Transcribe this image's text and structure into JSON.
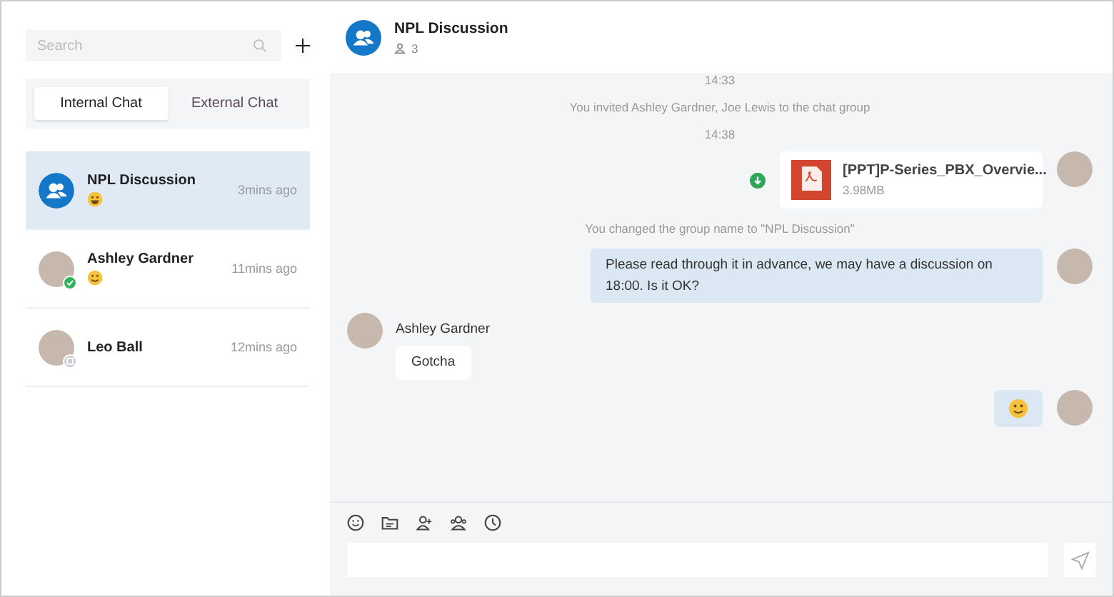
{
  "sidebar": {
    "search": {
      "placeholder": "Search"
    },
    "tabs": [
      {
        "label": "Internal Chat",
        "selected": true
      },
      {
        "label": "External Chat",
        "selected": false
      }
    ],
    "chats": [
      {
        "kind": "group",
        "name": "NPL Discussion",
        "emoji_preview": true,
        "time": "3mins ago",
        "selected": true
      },
      {
        "kind": "person",
        "name": "Ashley Gardner",
        "emoji_preview": true,
        "online": true,
        "time": "11mins ago",
        "selected": false
      },
      {
        "kind": "person",
        "name": "Leo Ball",
        "emoji_preview": false,
        "online": false,
        "time": "12mins ago",
        "selected": false
      }
    ]
  },
  "conversation": {
    "title": "NPL Discussion",
    "members": "3",
    "messages": [
      {
        "kind": "time",
        "text": "14:33"
      },
      {
        "kind": "system",
        "text": "You invited Ashley Gardner, Joe Lewis to the chat group"
      },
      {
        "kind": "time",
        "text": "14:38"
      },
      {
        "kind": "file",
        "name": "[PPT]P-Series_PBX_Overvie...",
        "size": "3.98MB"
      },
      {
        "kind": "system",
        "text": "You changed the group name to \"NPL Discussion\""
      },
      {
        "kind": "outgoing",
        "text": "Please read through it in advance, we may have a discussion on 18:00. Is it OK?"
      },
      {
        "kind": "incoming",
        "sender": "Ashley Gardner",
        "text": "Gotcha"
      },
      {
        "kind": "outgoing_emoji"
      }
    ]
  }
}
